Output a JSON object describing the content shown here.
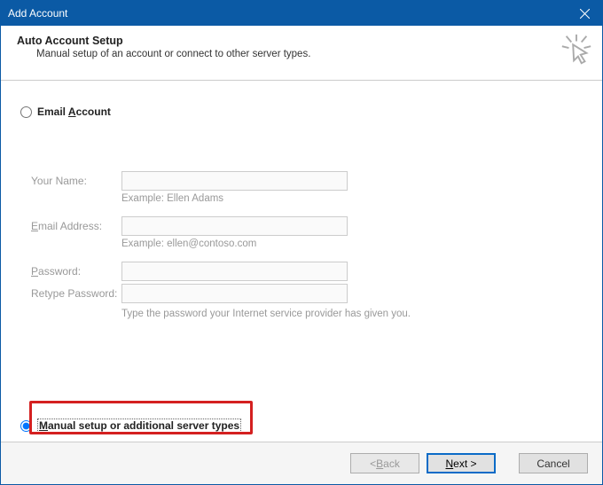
{
  "titlebar": {
    "title": "Add Account"
  },
  "header": {
    "title": "Auto Account Setup",
    "subtitle": "Manual setup of an account or connect to other server types."
  },
  "options": {
    "email_label_pre": "Email ",
    "email_label_ul": "A",
    "email_label_post": "ccount",
    "manual_label_ul": "M",
    "manual_label_post": "anual setup or additional server types"
  },
  "form": {
    "your_name": {
      "label": "Your Name:",
      "hint": "Example: Ellen Adams"
    },
    "email": {
      "label_ul": "E",
      "label_post": "mail Address:",
      "hint": "Example: ellen@contoso.com"
    },
    "password": {
      "label_ul": "P",
      "label_post": "assword:"
    },
    "retype": {
      "label": "Retype Password:",
      "hint": "Type the password your Internet service provider has given you."
    }
  },
  "footer": {
    "back_pre": "< ",
    "back_ul": "B",
    "back_post": "ack",
    "next_ul": "N",
    "next_post": "ext >",
    "cancel": "Cancel"
  }
}
